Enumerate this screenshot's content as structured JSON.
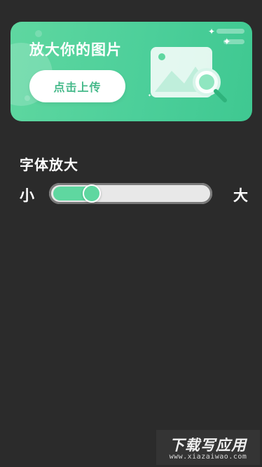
{
  "banner": {
    "title": "放大你的图片",
    "upload_button_label": "点击上传",
    "illustration_icon": "image-search-icon",
    "sparkle_icon": "sparkle-icon"
  },
  "font_zoom": {
    "title": "字体放大",
    "min_label": "小",
    "max_label": "大",
    "value_fraction": 0.25
  },
  "watermark": {
    "main": "下载写应用",
    "sub": "www.xiazaiwao.com"
  },
  "colors": {
    "background": "#2b2b2b",
    "accent": "#5fd7a0",
    "banner_gradient_end": "#3fc891",
    "track": "#e8e8e8",
    "button_text": "#45b98a"
  }
}
